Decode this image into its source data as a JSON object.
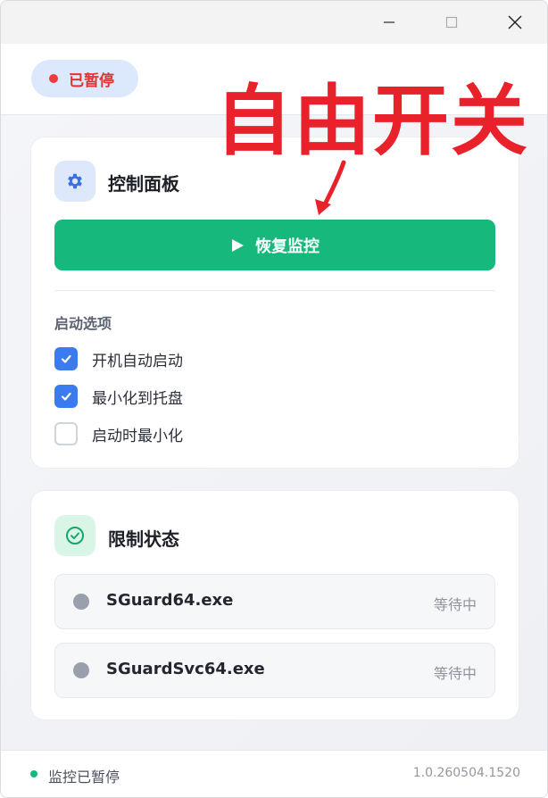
{
  "window": {
    "controls": {
      "minimize": "minimize-icon",
      "maximize": "maximize-icon",
      "close": "close-icon"
    }
  },
  "header": {
    "status_label": "已暂停",
    "status_color": "#e23232"
  },
  "annotation": {
    "text": "自由开关",
    "color": "#e8212a"
  },
  "control_panel": {
    "title": "控制面板",
    "icon": "gear-icon",
    "resume_button": "恢复监控",
    "resume_color": "#17b87b",
    "startup_section": "启动选项",
    "options": [
      {
        "label": "开机自动启动",
        "checked": true
      },
      {
        "label": "最小化到托盘",
        "checked": true
      },
      {
        "label": "启动时最小化",
        "checked": false
      }
    ]
  },
  "limit_status": {
    "title": "限制状态",
    "icon": "check-circle-icon",
    "processes": [
      {
        "name": "SGuard64.exe",
        "status": "等待中"
      },
      {
        "name": "SGuardSvc64.exe",
        "status": "等待中"
      }
    ]
  },
  "footer": {
    "status": "监控已暂停",
    "version": "1.0.260504.1520"
  }
}
